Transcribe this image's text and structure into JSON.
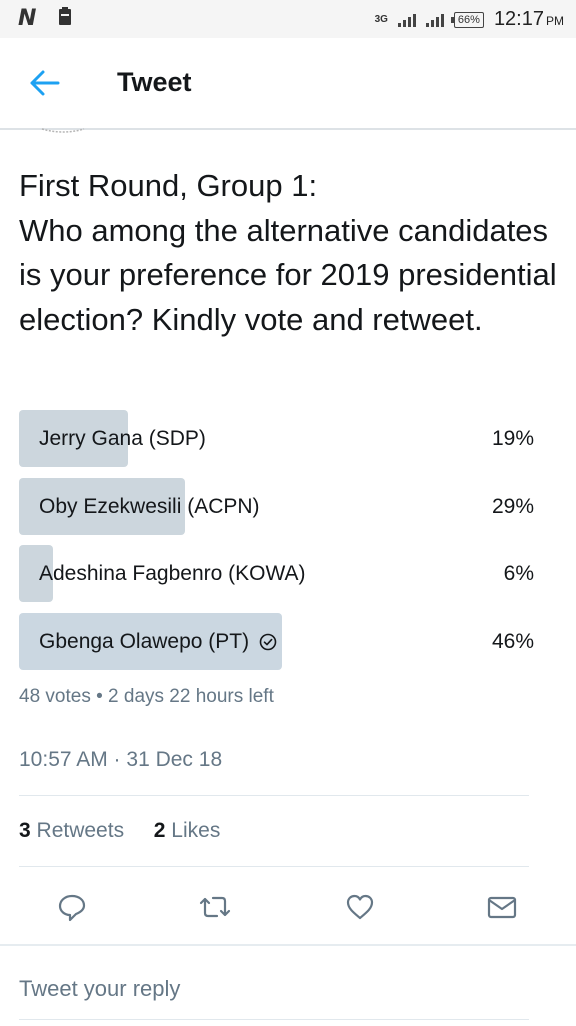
{
  "status_bar": {
    "network": "3G",
    "battery": "66%",
    "time": "12:17",
    "ampm": "PM"
  },
  "header": {
    "title": "Tweet"
  },
  "tweet": {
    "text": "First Round, Group 1:\nWho among the alternative candidates is your preference for 2019 presidential election? Kindly vote and retweet."
  },
  "poll": {
    "options": [
      {
        "label": "Jerry Gana (SDP)",
        "percent_text": "19%",
        "percent": 19,
        "winner": false
      },
      {
        "label": "Oby Ezekwesili (ACPN)",
        "percent_text": "29%",
        "percent": 29,
        "winner": false
      },
      {
        "label": "Adeshina Fagbenro (KOWA)",
        "percent_text": "6%",
        "percent": 6,
        "winner": false
      },
      {
        "label": "Gbenga Olawepo (PT)",
        "percent_text": "46%",
        "percent": 46,
        "winner": true
      }
    ],
    "meta": "48 votes • 2 days 22 hours left"
  },
  "timestamp": "10:57 AM · 31 Dec 18",
  "stats": {
    "retweets_count": "3",
    "retweets_label": "Retweets",
    "likes_count": "2",
    "likes_label": "Likes"
  },
  "actions": {
    "icons": [
      "reply-icon",
      "retweet-icon",
      "like-icon",
      "share-icon"
    ]
  },
  "reply": {
    "placeholder": "Tweet your reply"
  },
  "colors": {
    "accent": "#1da1f2",
    "secondary_text": "#657786",
    "poll_bar": "#ccd6dd"
  }
}
